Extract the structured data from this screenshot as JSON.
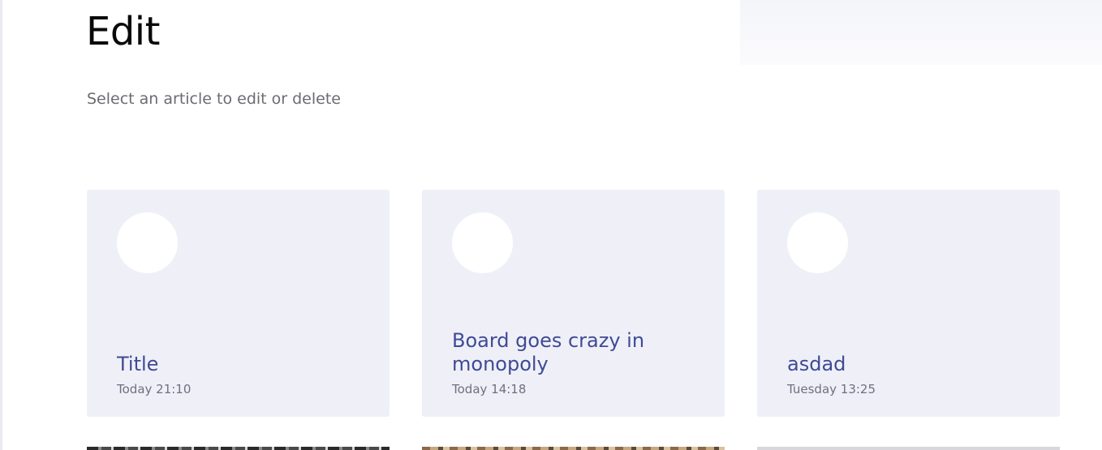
{
  "header": {
    "title": "Edit",
    "subtitle": "Select an article to edit or delete"
  },
  "articles": [
    {
      "title": "Title",
      "date": "Today 21:10"
    },
    {
      "title": "Board goes crazy in monopoly",
      "date": "Today 14:18"
    },
    {
      "title": "asdad",
      "date": "Tuesday 13:25"
    }
  ],
  "colors": {
    "card_background": "#eff0f7",
    "card_title": "#3f4a95",
    "card_date": "#6e7080",
    "subtitle": "#6b6b73"
  }
}
